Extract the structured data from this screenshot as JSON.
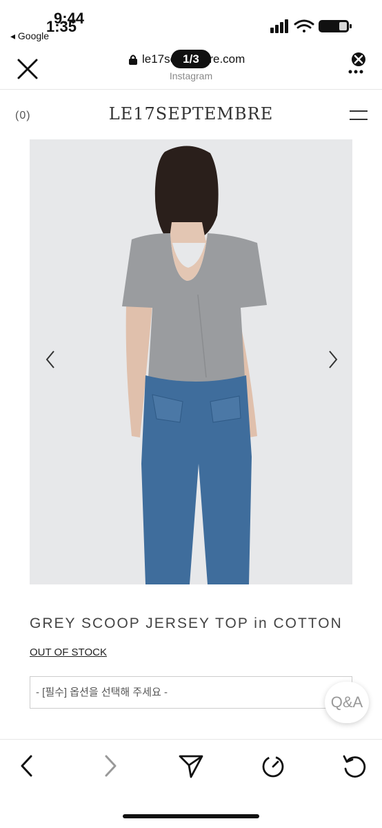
{
  "status": {
    "time_back": "9:44",
    "time_front": "1:35",
    "back_app": "◂ Google"
  },
  "browser": {
    "url": "le17septembre.com",
    "source": "Instagram",
    "slide_counter": "1/3"
  },
  "site": {
    "cart_count": "(0)",
    "brand": "LE17SEPTEMBRE"
  },
  "product": {
    "name": "GREY SCOOP JERSEY TOP in COTTON",
    "stock": "OUT OF STOCK",
    "option_placeholder": "- [필수] 옵션을 선택해 주세요 -",
    "qa_label": "Q&A"
  },
  "icons": {
    "close": "close-icon",
    "lock": "lock-icon",
    "more": "more-icon",
    "menu": "hamburger-icon",
    "prev": "chevron-left-icon",
    "next": "chevron-right-icon",
    "back": "back-icon",
    "forward": "forward-icon",
    "share": "send-icon",
    "timer": "timer-icon",
    "refresh": "refresh-icon"
  },
  "colors": {
    "brand_text": "#333333",
    "image_bg": "#e7e8ea",
    "toolbar_border": "#e6e6e6"
  }
}
